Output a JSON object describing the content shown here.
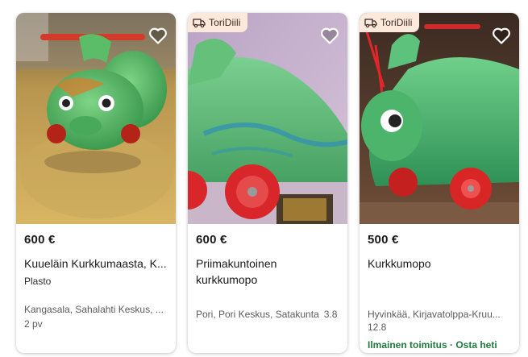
{
  "colors": {
    "badge_bg": "#fde8dc",
    "shipping_green": "#1f7a3d",
    "card_shadow": "rgba(0,0,0,0.22)"
  },
  "listings": [
    {
      "image_alt": "green caterpillar ride-on toy",
      "badge": null,
      "favorite_icon": "heart-outline-icon",
      "price": "600 €",
      "title": "Kuueläin Kurkkumaasta, K...",
      "subtitle": "Plasto",
      "location": "Kangasala, Sahalahti Keskus, ...",
      "date": "2 pv",
      "shipping": null
    },
    {
      "image_alt": "green caterpillar ride-on toy close-up",
      "badge": {
        "icon": "delivery-truck-icon",
        "label": "ToriDiili"
      },
      "favorite_icon": "heart-outline-icon",
      "price": "600 €",
      "title": "Priimakuntoinen kurkkumopo",
      "subtitle": null,
      "location": "Pori, Pori Keskus, Satakunta",
      "date": "3.8",
      "shipping": null
    },
    {
      "image_alt": "green caterpillar ride-on toy on floor",
      "badge": {
        "icon": "delivery-truck-icon",
        "label": "ToriDiili"
      },
      "favorite_icon": "heart-outline-icon",
      "price": "500 €",
      "title": "Kurkkumopo",
      "subtitle": null,
      "location": "Hyvinkää, Kirjavatolppa-Kruu...",
      "date": "12.8",
      "shipping": "Ilmainen toimitus · Osta heti"
    }
  ]
}
